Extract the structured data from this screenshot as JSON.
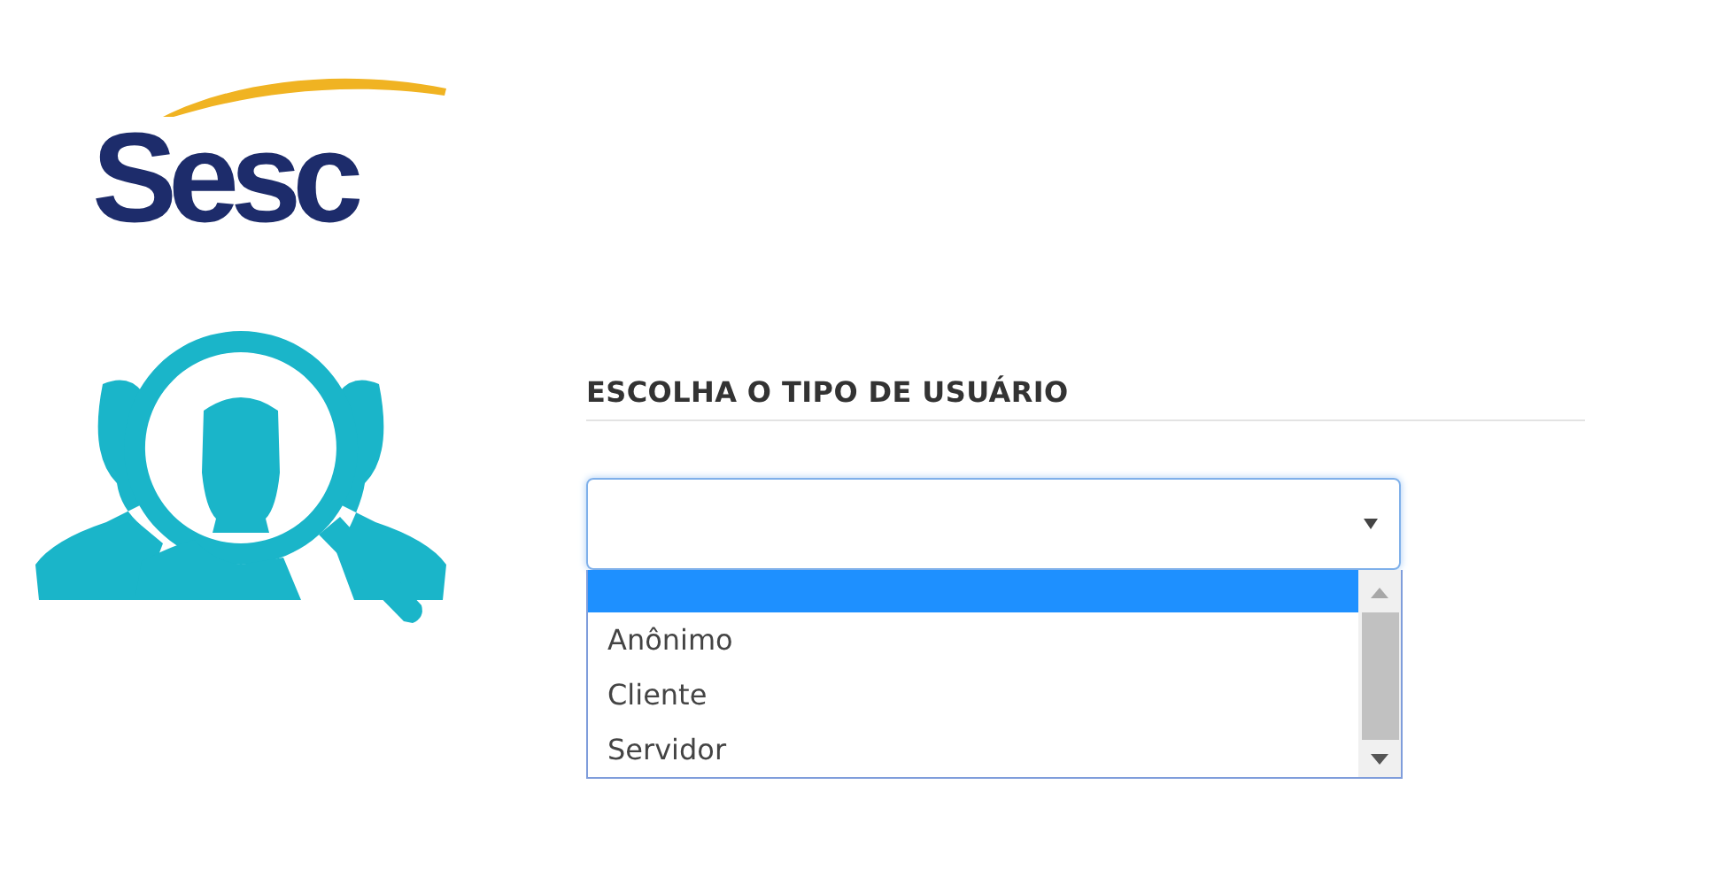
{
  "logo": {
    "text": "Sesc"
  },
  "form": {
    "heading": "ESCOLHA O TIPO DE USUÁRIO",
    "dropdown": {
      "expanded": true,
      "options": [
        {
          "selected": true
        },
        {
          "label": "Anônimo",
          "selected": false
        },
        {
          "label": "Cliente",
          "selected": false
        },
        {
          "label": "Servidor",
          "selected": false
        }
      ]
    }
  }
}
